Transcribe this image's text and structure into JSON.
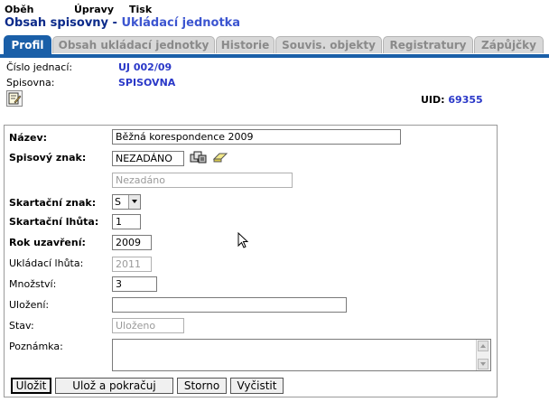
{
  "menu": {
    "items": [
      "Oběh",
      "Úpravy",
      "Tisk"
    ]
  },
  "title": {
    "main": "Obsah spisovny",
    "separator": " - ",
    "sub": "Ukládací jednotka"
  },
  "tabs": [
    "Profil",
    "Obsah ukládací jednotky",
    "Historie",
    "Souvis. objekty",
    "Registratury",
    "Zápůjčky"
  ],
  "info": {
    "cislo_label": "Číslo jednací:",
    "cislo_value": "UJ 002/09",
    "spisovna_label": "Spisovna:",
    "spisovna_value": "SPISOVNA",
    "uid_label": "UID:",
    "uid_value": "69355"
  },
  "form": {
    "nazev_label": "Název:",
    "nazev_value": "Běžná korespondence 2009",
    "spisovy_label": "Spisový znak:",
    "spisovy_value": "NEZADÁNO",
    "spisovy_desc": "Nezadáno",
    "skartacni_znak_label": "Skartační znak:",
    "skartacni_znak_value": "S",
    "skartacni_lhuta_label": "Skartační lhůta:",
    "skartacni_lhuta_value": "1",
    "rok_label": "Rok uzavření:",
    "rok_value": "2009",
    "ukladaci_label": "Ukládací lhůta:",
    "ukladaci_value": "2011",
    "mnozstvi_label": "Množství:",
    "mnozstvi_value": "3",
    "ulozeni_label": "Uložení:",
    "ulozeni_value": "",
    "stav_label": "Stav:",
    "stav_value": "Uloženo",
    "poznamka_label": "Poznámka:",
    "poznamka_value": ""
  },
  "buttons": {
    "save": "Uložit",
    "save_continue": "Ulož a pokračuj",
    "cancel": "Storno",
    "clear": "Vyčistit"
  },
  "colors": {
    "tab_active": "#1a5fa8",
    "title": "#0b2a8a",
    "value_blue": "#2a38c8"
  },
  "icons": {
    "edit": "edit-icon",
    "lookup": "lookup-icon",
    "eraser": "eraser-icon"
  }
}
